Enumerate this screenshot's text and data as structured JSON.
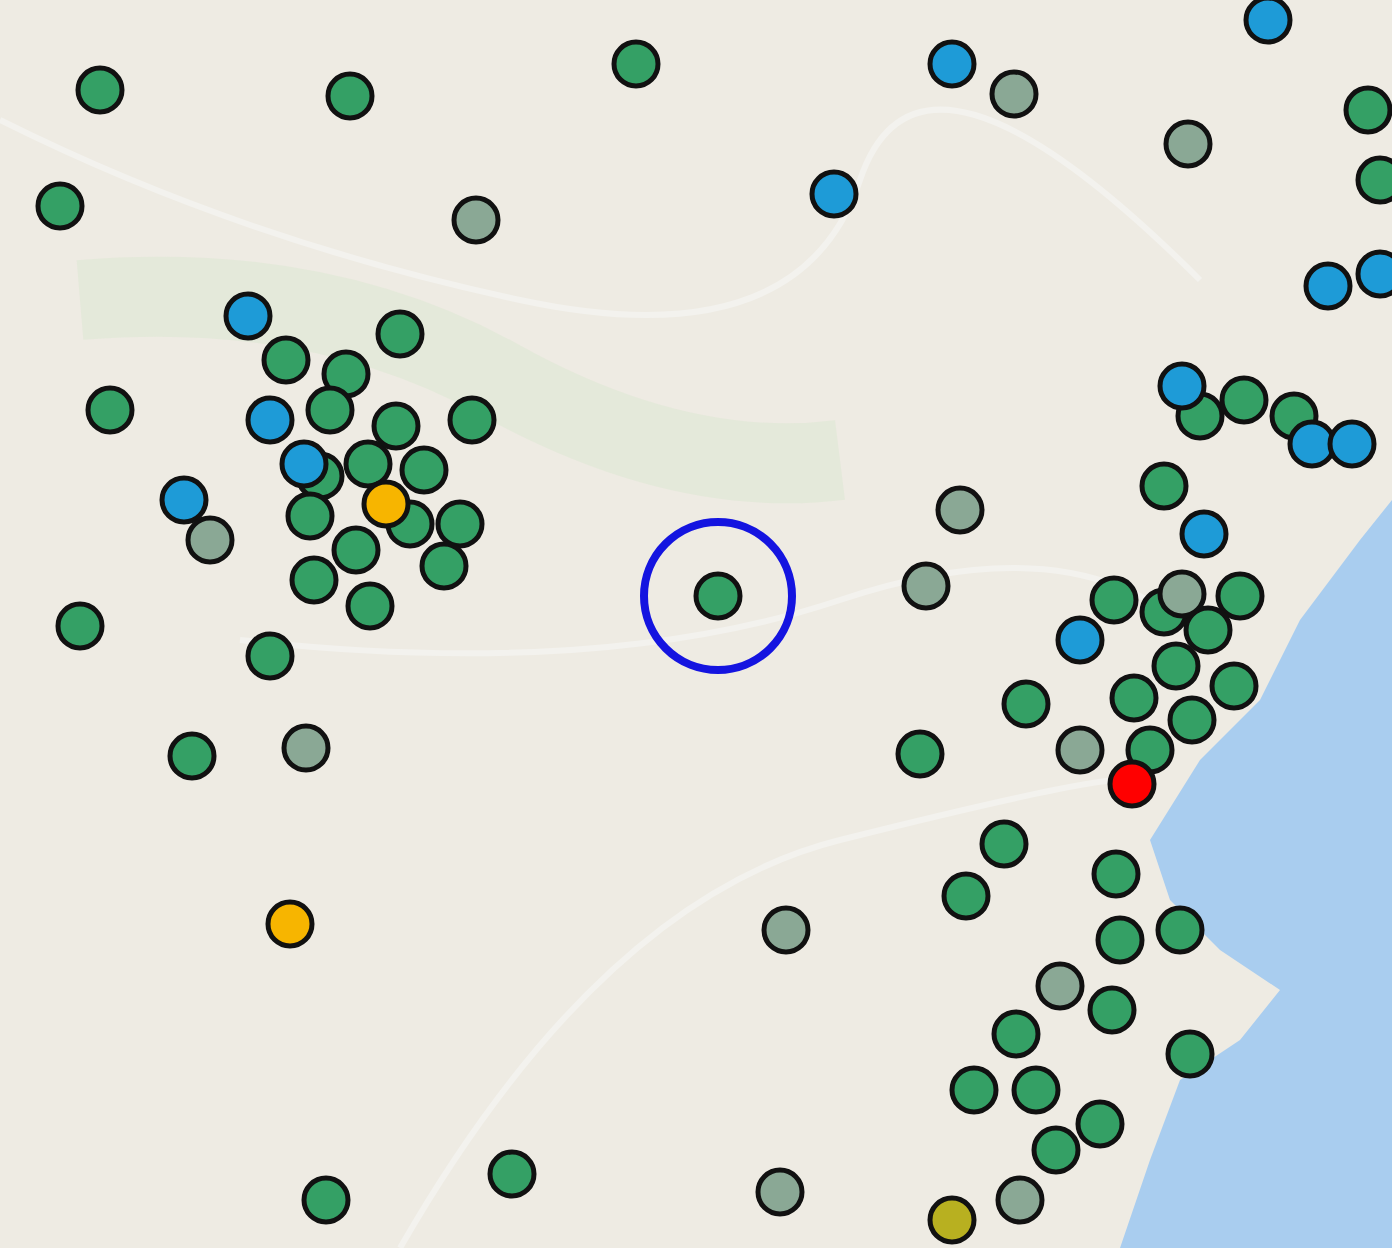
{
  "map": {
    "markers": [
      {
        "color": "#34a065",
        "selected": false
      },
      {
        "color": "#34a065",
        "selected": false
      },
      {
        "color": "#34a065",
        "selected": false
      },
      {
        "color": "#34a065",
        "selected": false
      },
      {
        "color": "#34a065",
        "selected": false
      },
      {
        "color": "#34a065",
        "selected": false
      },
      {
        "color": "#34a065",
        "selected": false
      },
      {
        "color": "#34a065",
        "selected": false
      },
      {
        "color": "#34a065",
        "selected": false
      },
      {
        "color": "#34a065",
        "selected": false
      },
      {
        "color": "#34a065",
        "selected": false
      },
      {
        "color": "#34a065",
        "selected": false
      },
      {
        "color": "#34a065",
        "selected": false
      },
      {
        "color": "#34a065",
        "selected": false
      },
      {
        "color": "#34a065",
        "selected": false
      },
      {
        "color": "#34a065",
        "selected": false
      },
      {
        "color": "#34a065",
        "selected": false
      },
      {
        "color": "#34a065",
        "selected": false
      },
      {
        "color": "#34a065",
        "selected": false
      },
      {
        "color": "#34a065",
        "selected": false
      },
      {
        "color": "#34a065",
        "selected": false
      },
      {
        "color": "#34a065",
        "selected": false
      },
      {
        "color": "#34a065",
        "selected": false
      },
      {
        "color": "#34a065",
        "selected": false
      },
      {
        "color": "#34a065",
        "selected": false
      },
      {
        "color": "#34a065",
        "selected": false
      },
      {
        "color": "#34a065",
        "selected": true
      },
      {
        "color": "#34a065",
        "selected": false
      },
      {
        "color": "#34a065",
        "selected": false
      },
      {
        "color": "#34a065",
        "selected": false
      },
      {
        "color": "#34a065",
        "selected": false
      },
      {
        "color": "#34a065",
        "selected": false
      },
      {
        "color": "#34a065",
        "selected": false
      },
      {
        "color": "#34a065",
        "selected": false
      },
      {
        "color": "#34a065",
        "selected": false
      },
      {
        "color": "#34a065",
        "selected": false
      },
      {
        "color": "#34a065",
        "selected": false
      },
      {
        "color": "#34a065",
        "selected": false
      },
      {
        "color": "#34a065",
        "selected": false
      },
      {
        "color": "#34a065",
        "selected": false
      },
      {
        "color": "#34a065",
        "selected": false
      },
      {
        "color": "#34a065",
        "selected": false
      },
      {
        "color": "#34a065",
        "selected": false
      },
      {
        "color": "#34a065",
        "selected": false
      },
      {
        "color": "#34a065",
        "selected": false
      },
      {
        "color": "#34a065",
        "selected": false
      },
      {
        "color": "#34a065",
        "selected": false
      },
      {
        "color": "#34a065",
        "selected": false
      },
      {
        "color": "#34a065",
        "selected": false
      },
      {
        "color": "#34a065",
        "selected": false
      },
      {
        "color": "#34a065",
        "selected": false
      },
      {
        "color": "#34a065",
        "selected": false
      },
      {
        "color": "#34a065",
        "selected": false
      },
      {
        "color": "#34a065",
        "selected": false
      },
      {
        "color": "#34a065",
        "selected": false
      },
      {
        "color": "#34a065",
        "selected": false
      },
      {
        "color": "#1e9bd7",
        "selected": false
      },
      {
        "color": "#1e9bd7",
        "selected": false
      },
      {
        "color": "#1e9bd7",
        "selected": false
      },
      {
        "color": "#1e9bd7",
        "selected": false
      },
      {
        "color": "#1e9bd7",
        "selected": false
      },
      {
        "color": "#1e9bd7",
        "selected": false
      },
      {
        "color": "#1e9bd7",
        "selected": false
      },
      {
        "color": "#1e9bd7",
        "selected": false
      },
      {
        "color": "#1e9bd7",
        "selected": false
      },
      {
        "color": "#1e9bd7",
        "selected": false
      },
      {
        "color": "#1e9bd7",
        "selected": false
      },
      {
        "color": "#1e9bd7",
        "selected": false
      },
      {
        "color": "#1e9bd7",
        "selected": false
      },
      {
        "color": "#1e9bd7",
        "selected": false
      },
      {
        "color": "#8aa895",
        "selected": false
      },
      {
        "color": "#8aa895",
        "selected": false
      },
      {
        "color": "#8aa895",
        "selected": false
      },
      {
        "color": "#8aa895",
        "selected": false
      },
      {
        "color": "#8aa895",
        "selected": false
      },
      {
        "color": "#8aa895",
        "selected": false
      },
      {
        "color": "#8aa895",
        "selected": false
      },
      {
        "color": "#8aa895",
        "selected": false
      },
      {
        "color": "#8aa895",
        "selected": false
      },
      {
        "color": "#8aa895",
        "selected": false
      },
      {
        "color": "#8aa895",
        "selected": false
      },
      {
        "color": "#8aa895",
        "selected": false
      },
      {
        "color": "#8aa895",
        "selected": false
      },
      {
        "color": "#f7b500",
        "selected": false
      },
      {
        "color": "#f7b500",
        "selected": false
      },
      {
        "color": "#b8b020",
        "selected": false
      },
      {
        "color": "#ff0000",
        "selected": false
      }
    ]
  }
}
